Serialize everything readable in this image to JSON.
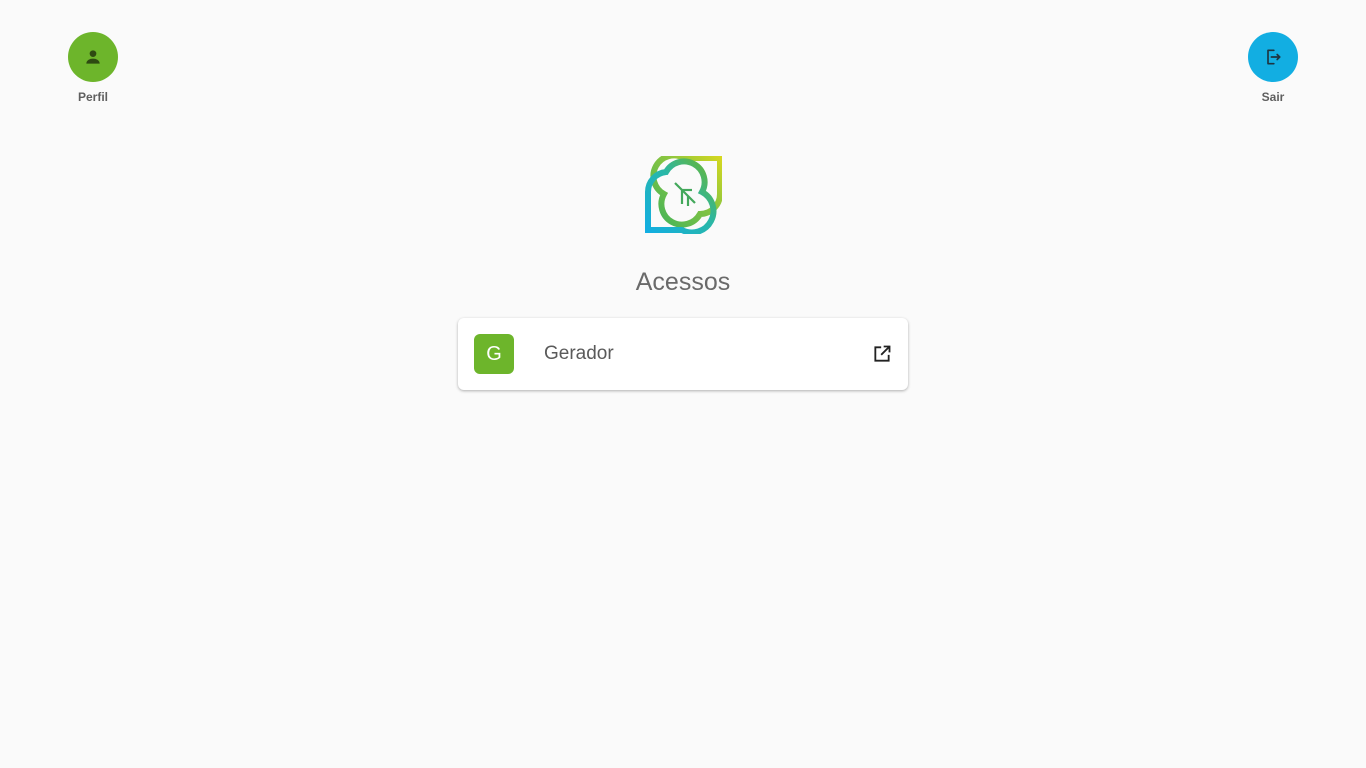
{
  "header": {
    "profile": {
      "label": "Perfil",
      "icon": "person-icon",
      "color": "#6db52b"
    },
    "logout": {
      "label": "Sair",
      "icon": "logout-icon",
      "color": "#12aee2"
    }
  },
  "main": {
    "logo_icon": "leaf-logo-icon",
    "title": "Acessos",
    "items": [
      {
        "avatar_letter": "G",
        "label": "Gerador",
        "avatar_color": "#6db52b",
        "action_icon": "open-in-new-icon"
      }
    ]
  }
}
